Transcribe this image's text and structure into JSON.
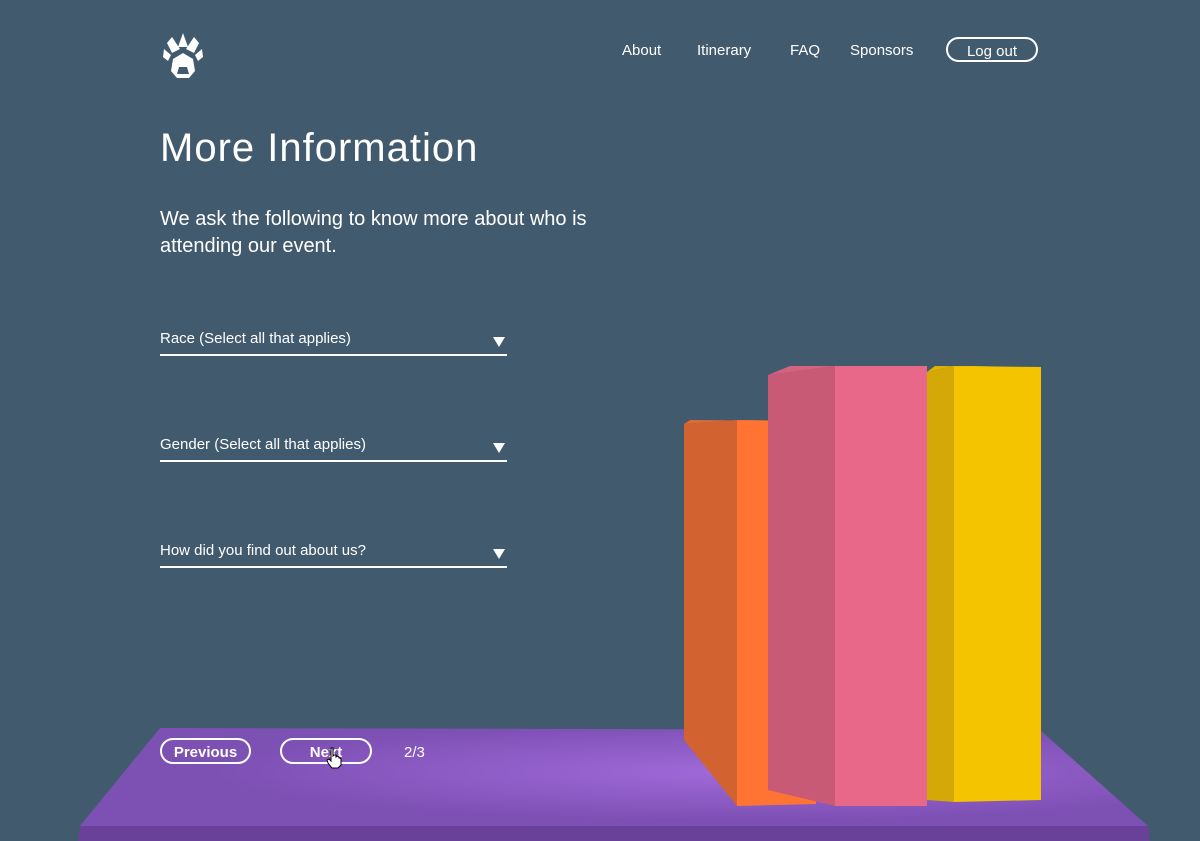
{
  "brand": {
    "logo_icon": "paw-shield-icon"
  },
  "nav": {
    "items": [
      {
        "label": "About"
      },
      {
        "label": "Itinerary"
      },
      {
        "label": "FAQ"
      },
      {
        "label": "Sponsors"
      }
    ],
    "logout_label": "Log out"
  },
  "main": {
    "title": "More Information",
    "intro": "We ask the following to know more about who is attending our event.",
    "selects": [
      {
        "label": "Race (Select all that applies)"
      },
      {
        "label": "Gender (Select all that applies)"
      },
      {
        "label": "How did you find out about us?"
      }
    ]
  },
  "pager": {
    "previous_label": "Previous",
    "next_label": "Next",
    "page_indicator": "2/3"
  },
  "colors": {
    "background": "#415a6e",
    "platform": "#7b4fb0",
    "book_orange": "#ff7433",
    "book_pink": "#e8688a",
    "book_yellow": "#f5c400"
  }
}
